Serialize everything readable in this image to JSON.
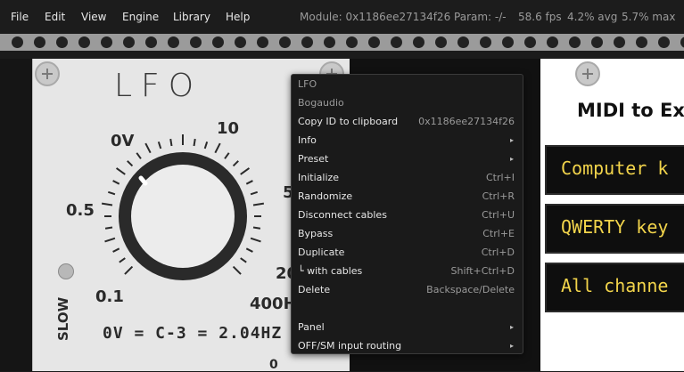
{
  "menubar": {
    "items": [
      "File",
      "Edit",
      "View",
      "Engine",
      "Library",
      "Help"
    ],
    "status": "Module: 0x1186ee27134f26 Param: -/-",
    "fps": "58.6 fps",
    "avg": "4.2% avg",
    "max": "5.7% max"
  },
  "lfo": {
    "title": "LFO",
    "scale": [
      "0V",
      "10",
      "0.5",
      "5",
      "0.1",
      "20",
      "400H",
      "0"
    ],
    "slow_label": "SLOW",
    "readout": "0V = C-3 = 2.04HZ"
  },
  "midi": {
    "title": "MIDI to Ex",
    "rows": [
      "Computer k",
      "QWERTY key",
      "All channe"
    ]
  },
  "context_menu": {
    "header": "LFO",
    "brand": "Bogaudio",
    "items": [
      {
        "label": "Copy ID to clipboard",
        "right": "0x1186ee27134f26"
      },
      {
        "label": "Info",
        "arrow": "▸"
      },
      {
        "label": "Preset",
        "arrow": "▸"
      },
      {
        "label": "Initialize",
        "right": "Ctrl+I"
      },
      {
        "label": "Randomize",
        "right": "Ctrl+R"
      },
      {
        "label": "Disconnect cables",
        "right": "Ctrl+U"
      },
      {
        "label": "Bypass",
        "right": "Ctrl+E"
      },
      {
        "label": "Duplicate",
        "right": "Ctrl+D"
      },
      {
        "label": "└ with cables",
        "right": "Shift+Ctrl+D"
      },
      {
        "label": "Delete",
        "right": "Backspace/Delete"
      },
      {
        "label": "Panel",
        "arrow": "▸"
      },
      {
        "label": "OFF/SM input routing",
        "arrow": "▸"
      }
    ]
  },
  "colors": {
    "menubar_bg": "#1c1c1c",
    "rail": "#9b9b9b",
    "lfo_panel": "#e6e6e6",
    "knob": "#2a2a2a",
    "midi_text": "#f2d44b"
  },
  "icons": {
    "screw": "screw-icon",
    "submenu": "chevron-right-icon"
  }
}
